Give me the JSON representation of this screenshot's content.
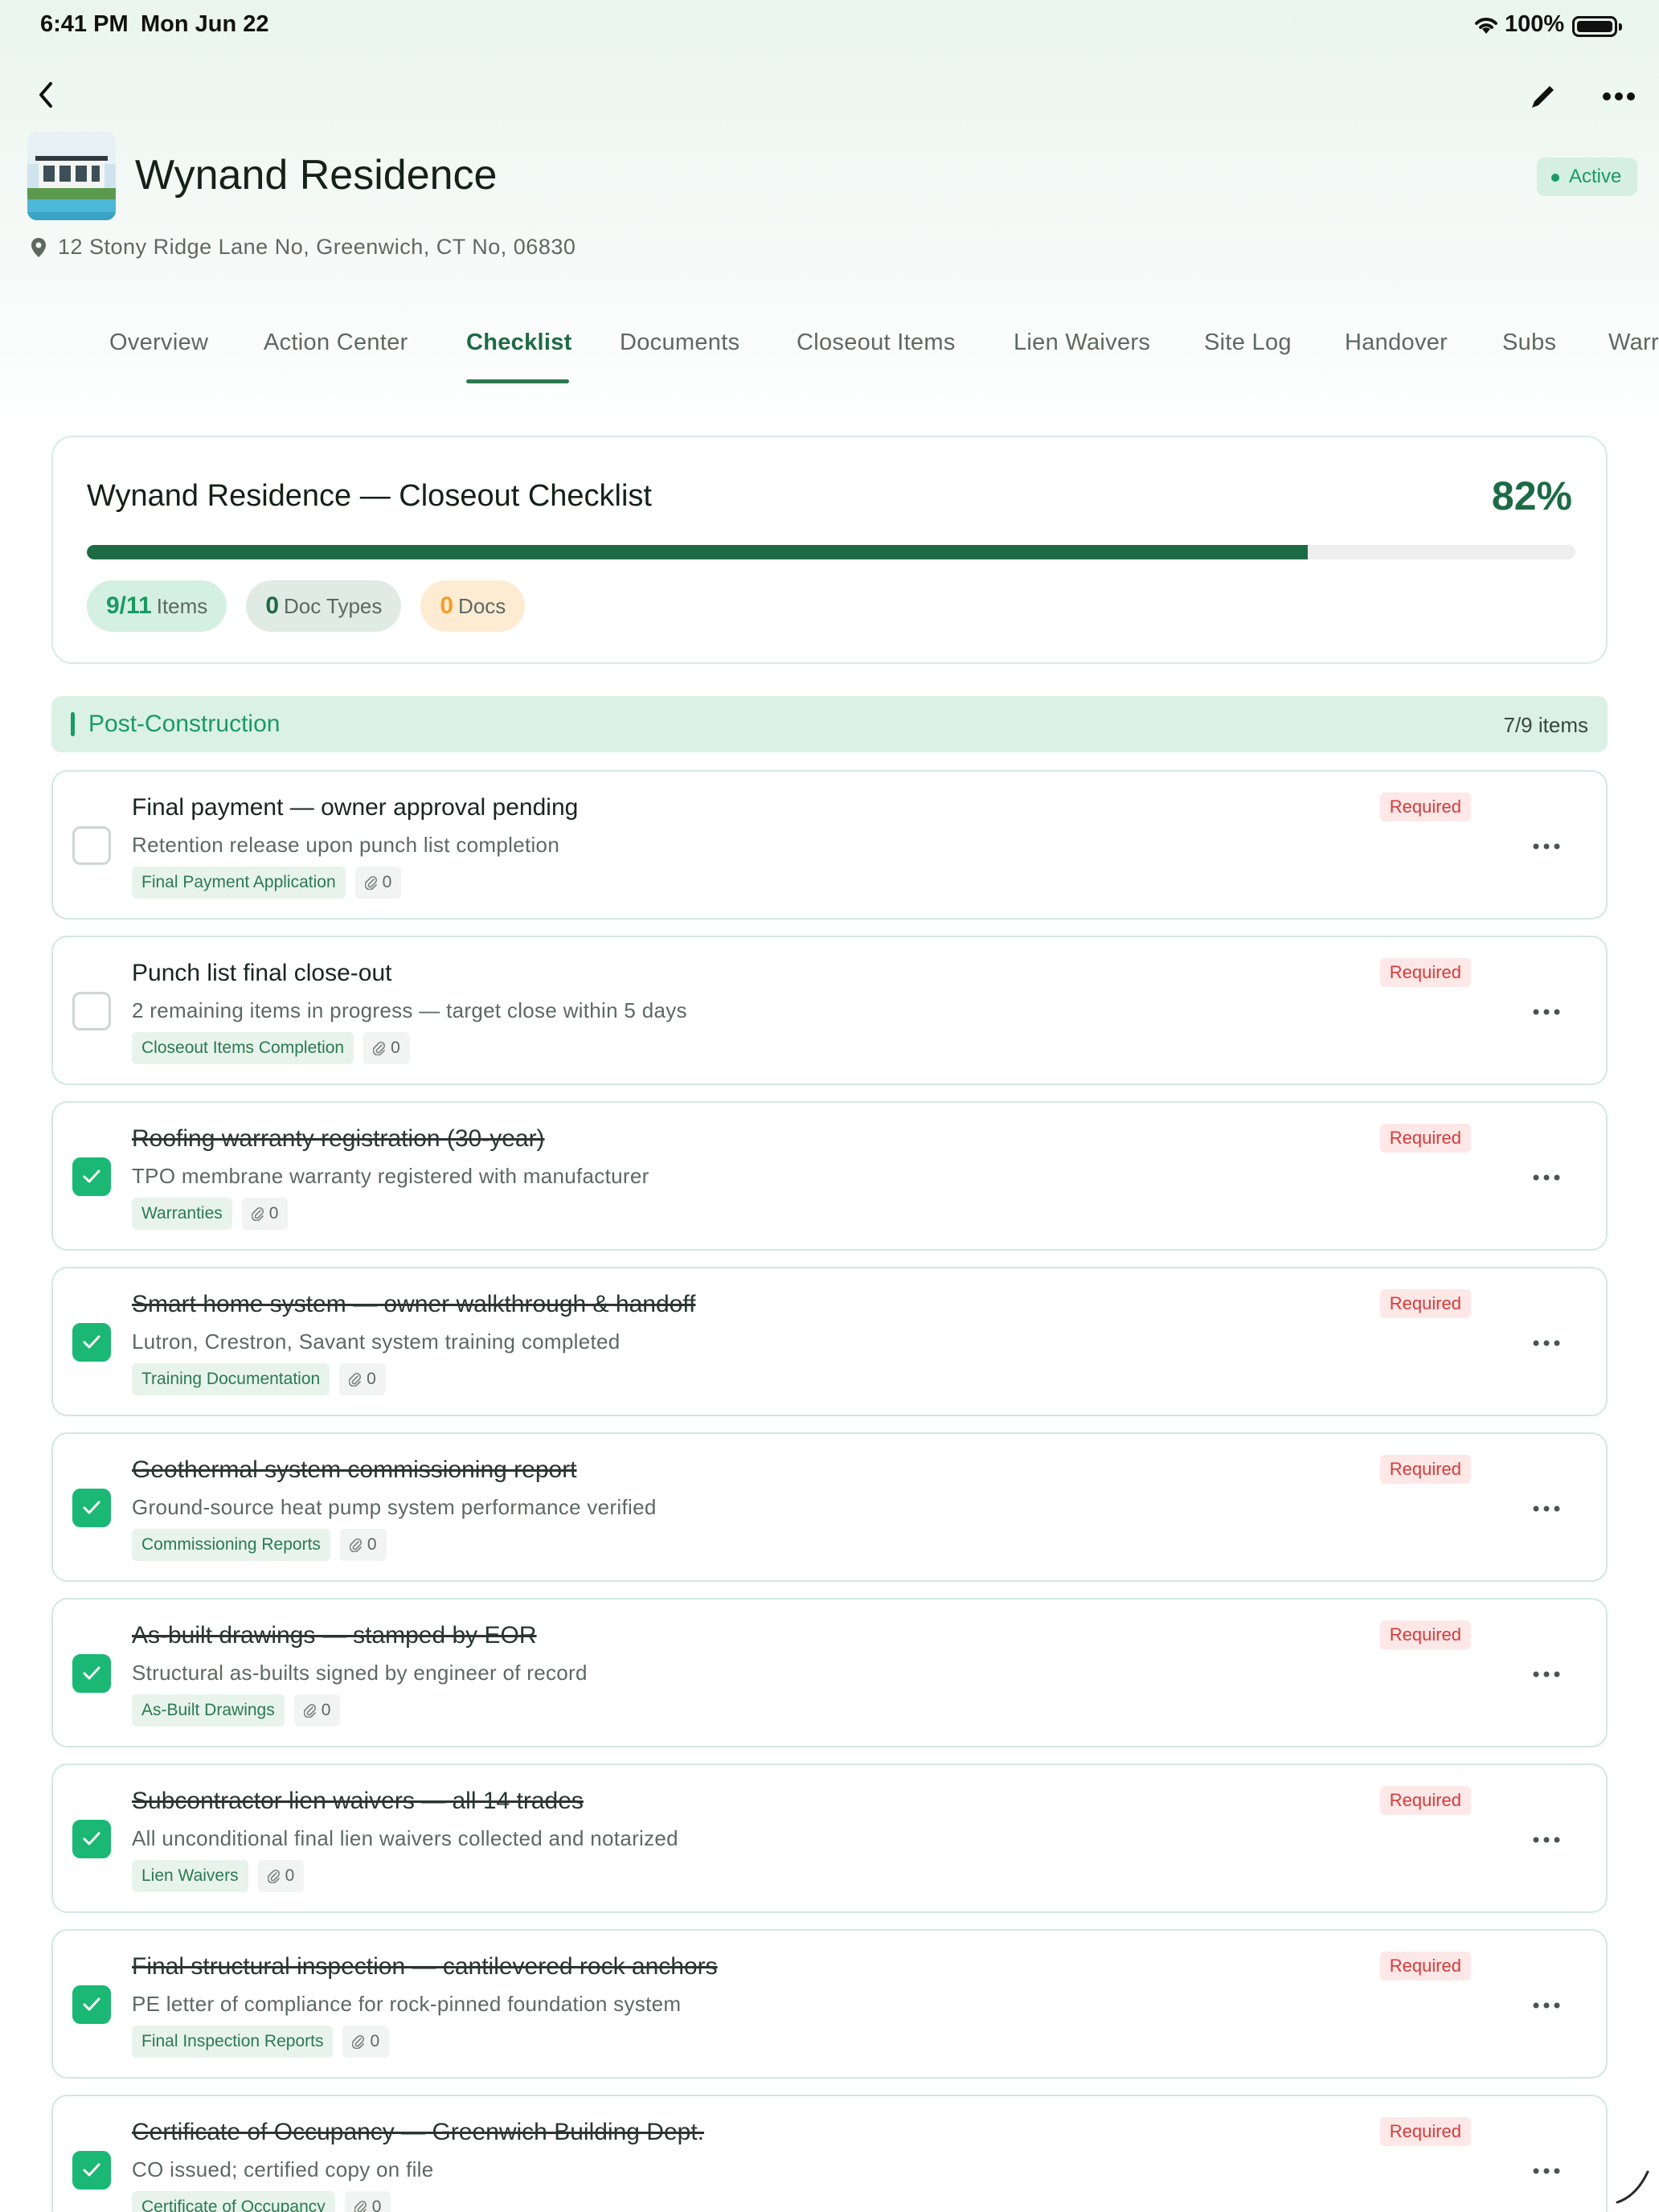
{
  "status_bar": {
    "time": "6:41 PM",
    "date": "Mon Jun 22",
    "battery": "100%"
  },
  "header": {
    "title": "Wynand Residence",
    "status": "Active",
    "address": "12 Stony Ridge Lane No, Greenwich, CT No, 06830"
  },
  "tabs": [
    "Overview",
    "Action Center",
    "Checklist",
    "Documents",
    "Closeout Items",
    "Lien Waivers",
    "Site Log",
    "Handover",
    "Subs",
    "Warr"
  ],
  "active_tab": "Checklist",
  "summary": {
    "title": "Wynand Residence — Closeout Checklist",
    "percent_label": "82%",
    "progress": 0.82,
    "chips": {
      "items_value": "9/11",
      "items_label": "Items",
      "doctypes_value": "0",
      "doctypes_label": "Doc Types",
      "docs_value": "0",
      "docs_label": "Docs"
    }
  },
  "section": {
    "title": "Post-Construction",
    "count": "7/9 items"
  },
  "required_label": "Required",
  "items": [
    {
      "title": "Final payment — owner approval pending",
      "desc": "Retention release upon punch list completion",
      "tag": "Final Payment Application",
      "attachments": "0",
      "done": false
    },
    {
      "title": "Punch list final close-out",
      "desc": "2 remaining items in progress — target close within 5 days",
      "tag": "Closeout Items Completion",
      "attachments": "0",
      "done": false
    },
    {
      "title": "Roofing warranty registration (30-year)",
      "desc": "TPO membrane warranty registered with manufacturer",
      "tag": "Warranties",
      "attachments": "0",
      "done": true
    },
    {
      "title": "Smart home system — owner walkthrough & handoff",
      "desc": "Lutron, Crestron, Savant system training completed",
      "tag": "Training Documentation",
      "attachments": "0",
      "done": true
    },
    {
      "title": "Geothermal system commissioning report",
      "desc": "Ground-source heat pump system performance verified",
      "tag": "Commissioning Reports",
      "attachments": "0",
      "done": true
    },
    {
      "title": "As-built drawings — stamped by EOR",
      "desc": "Structural as-builts signed by engineer of record",
      "tag": "As-Built Drawings",
      "attachments": "0",
      "done": true
    },
    {
      "title": "Subcontractor lien waivers — all 14 trades",
      "desc": "All unconditional final lien waivers collected and notarized",
      "tag": "Lien Waivers",
      "attachments": "0",
      "done": true
    },
    {
      "title": "Final structural inspection — cantilevered rock anchors",
      "desc": "PE letter of compliance for rock-pinned foundation system",
      "tag": "Final Inspection Reports",
      "attachments": "0",
      "done": true
    },
    {
      "title": "Certificate of Occupancy — Greenwich Building Dept.",
      "desc": "CO issued; certified copy on file",
      "tag": "Certificate of Occupancy",
      "attachments": "0",
      "done": true
    }
  ],
  "colors": {
    "accent": "#1d6b45",
    "check": "#1ab874",
    "required": "#d63a3a"
  }
}
